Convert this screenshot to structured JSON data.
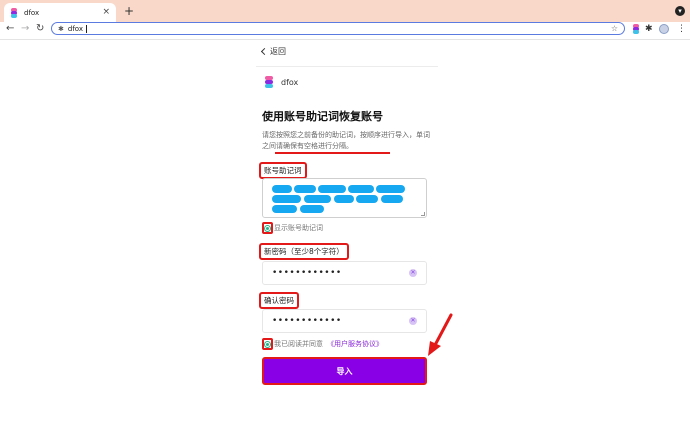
{
  "browser": {
    "tab_title": "dfox",
    "tab_close": "×",
    "new_tab": "+",
    "url": "dfox",
    "back_arrow": "←",
    "forward_arrow": "→",
    "reload_icon": "↻",
    "star_icon": "☆",
    "menu_icon": "⋮",
    "puzzle_icon": "✱"
  },
  "page": {
    "back_label": "返回",
    "brand_name": "dfox",
    "title": "使用账号助记词恢复账号",
    "description": "请您按照您之前备份的助记词，按顺序进行导入，单词之间请确保有空格进行分隔。",
    "mnemonic": {
      "label": "账号助记词",
      "show_label": "显示账号助记词"
    },
    "new_password": {
      "label": "新密码（至少8个字符）",
      "value": "••••••••••••"
    },
    "confirm_password": {
      "label": "确认密码",
      "value": "••••••••••••"
    },
    "agreement": {
      "prefix": "我已阅读并同意",
      "link": "《用户服务协议》"
    },
    "submit_label": "导入"
  },
  "colors": {
    "accent": "#8a00e6",
    "annotation_red": "#e31818",
    "redaction_blue": "#16a8f0",
    "check_green": "#2ab38a"
  }
}
